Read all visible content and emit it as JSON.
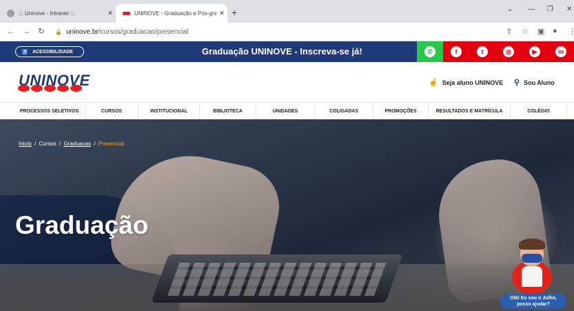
{
  "browser": {
    "tabs": [
      {
        "title": "::: Uninove - Intranet :::",
        "active": false
      },
      {
        "title": "UNINOVE - Graduação e Pós-gra",
        "active": true
      }
    ],
    "new_tab": "+",
    "url_host": "uninove.br",
    "url_path": "/cursos/graduacao/presencial"
  },
  "topbar": {
    "accessibility": "ACESSIBILIDADE",
    "promo": "Graduação UNINOVE - Inscreva-se já!",
    "social": [
      {
        "name": "whatsapp-icon",
        "color": "#25c84a"
      },
      {
        "name": "facebook-icon",
        "color": "#e3000f"
      },
      {
        "name": "twitter-icon",
        "color": "#e3000f"
      },
      {
        "name": "instagram-icon",
        "color": "#e3000f"
      },
      {
        "name": "youtube-icon",
        "color": "#e3000f"
      },
      {
        "name": "linkedin-icon",
        "color": "#e3000f"
      }
    ]
  },
  "header": {
    "logo": "UNINOVE",
    "seja_aluno": "Seja aluno UNINOVE",
    "sou_aluno": "Sou Aluno"
  },
  "nav": {
    "items": [
      "PROCESSOS SELETIVOS",
      "CURSOS",
      "INSTITUCIONAL",
      "BIBLIOTECA",
      "UNIDADES",
      "COLIGADAS",
      "PROMOÇÕES",
      "RESULTADOS E MATRÍCULA",
      "COLÉGIO"
    ]
  },
  "hero": {
    "breadcrumb": {
      "home": "Inicio",
      "cursos": "Cursos",
      "graduacao": "Graduacao",
      "current": "Presencial",
      "sep": "/"
    },
    "title": "Graduação"
  },
  "chat": {
    "line1": "Olá! Eu sou o Julho,",
    "line2": "posso ajudar?"
  },
  "colors": {
    "brand_blue": "#1e3a78",
    "brand_red": "#e31e24",
    "breadcrumb_current": "#f5a623"
  }
}
